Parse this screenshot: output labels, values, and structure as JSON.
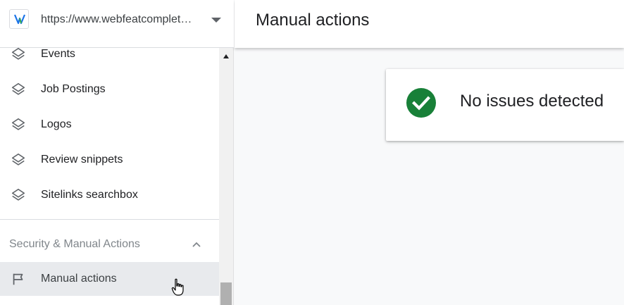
{
  "property": {
    "url": "https://www.webfeatcompletesolutions.com/",
    "favicon_icon": "webfeat-logo-icon"
  },
  "sidebar": {
    "items": [
      {
        "label": "Events",
        "icon": "layers-icon"
      },
      {
        "label": "Job Postings",
        "icon": "layers-icon"
      },
      {
        "label": "Logos",
        "icon": "layers-icon"
      },
      {
        "label": "Review snippets",
        "icon": "layers-icon"
      },
      {
        "label": "Sitelinks searchbox",
        "icon": "layers-icon"
      }
    ],
    "section": {
      "label": "Security & Manual Actions",
      "expanded": true,
      "items": [
        {
          "label": "Manual actions",
          "icon": "flag-icon",
          "active": true
        }
      ]
    }
  },
  "header": {
    "title": "Manual actions"
  },
  "main": {
    "status": {
      "text": "No issues detected",
      "icon": "check-circle-icon",
      "color": "#188038"
    }
  },
  "colors": {
    "active_item_bg": "#e8eaed",
    "success": "#188038",
    "section_label": "#80868b"
  }
}
